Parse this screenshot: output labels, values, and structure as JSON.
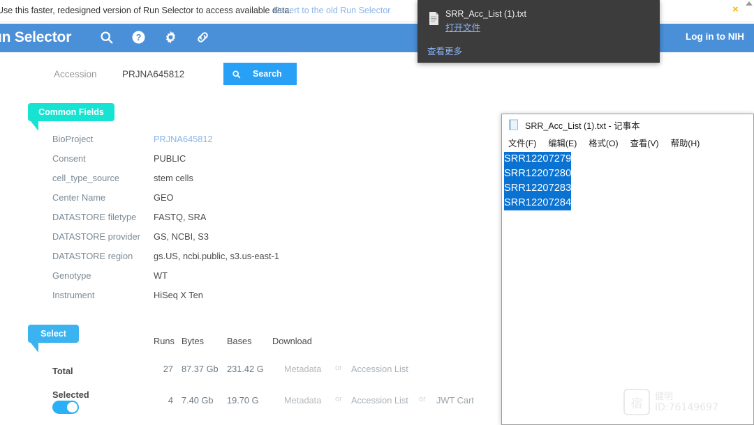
{
  "notice": {
    "text": "Use this faster, redesigned version of Run Selector to access available data.",
    "link": "Revert to the old Run Selector",
    "close": "×"
  },
  "header": {
    "title": "un Selector",
    "login": "Log in to NIH",
    "icons": [
      "search-icon",
      "help-icon",
      "gear-icon",
      "link-icon"
    ]
  },
  "search": {
    "label": "Accession",
    "value": "PRJNA645812",
    "button": "Search"
  },
  "common_fields": {
    "tag": "Common Fields",
    "rows": [
      {
        "key": "BioProject",
        "value": "PRJNA645812",
        "is_link": true
      },
      {
        "key": "Consent",
        "value": "PUBLIC",
        "is_link": false
      },
      {
        "key": "cell_type_source",
        "value": "stem cells",
        "is_link": false
      },
      {
        "key": "Center Name",
        "value": "GEO",
        "is_link": false
      },
      {
        "key": "DATASTORE filetype",
        "value": "FASTQ, SRA",
        "is_link": false
      },
      {
        "key": "DATASTORE provider",
        "value": "GS, NCBI, S3",
        "is_link": false
      },
      {
        "key": "DATASTORE region",
        "value": "gs.US, ncbi.public, s3.us-east-1",
        "is_link": false
      },
      {
        "key": "Genotype",
        "value": "WT",
        "is_link": false
      },
      {
        "key": "Instrument",
        "value": "HiSeq X Ten",
        "is_link": false
      }
    ]
  },
  "select": {
    "tag": "Select",
    "columns": {
      "runs": "Runs",
      "bytes": "Bytes",
      "bases": "Bases",
      "download": "Download"
    },
    "total": {
      "label": "Total",
      "runs": "27",
      "bytes": "87.37 Gb",
      "bases": "231.42 G",
      "metadata": "Metadata",
      "or": "or",
      "accession_list": "Accession List"
    },
    "selected": {
      "label": "Selected",
      "runs": "4",
      "bytes": "7.40 Gb",
      "bases": "19.70 G",
      "metadata": "Metadata",
      "or1": "or",
      "accession_list": "Accession List",
      "or2": "or",
      "jwt_cart": "JWT Cart"
    }
  },
  "download_popup": {
    "filename": "SRR_Acc_List (1).txt",
    "open_file": "打开文件",
    "view_more": "查看更多"
  },
  "notepad": {
    "title": "SRR_Acc_List (1).txt - 记事本",
    "menus": [
      "文件(F)",
      "编辑(E)",
      "格式(O)",
      "查看(V)",
      "帮助(H)"
    ],
    "lines": [
      "SRR12207279",
      "SRR12207280",
      "SRR12207283",
      "SRR12207284"
    ]
  },
  "watermark": {
    "logo": "宿",
    "name": "健明",
    "id": "ID:76149697"
  },
  "colors": {
    "header_blue": "#4a90d9",
    "search_blue": "#27a0f5",
    "tag_teal": "#17e3d2",
    "tag_blue": "#3bb3f0",
    "link_blue": "#8ab4e8",
    "popup_dark": "#3c3c3c",
    "selection_blue": "#0a72d1",
    "close_yellow": "#f5b50a"
  }
}
